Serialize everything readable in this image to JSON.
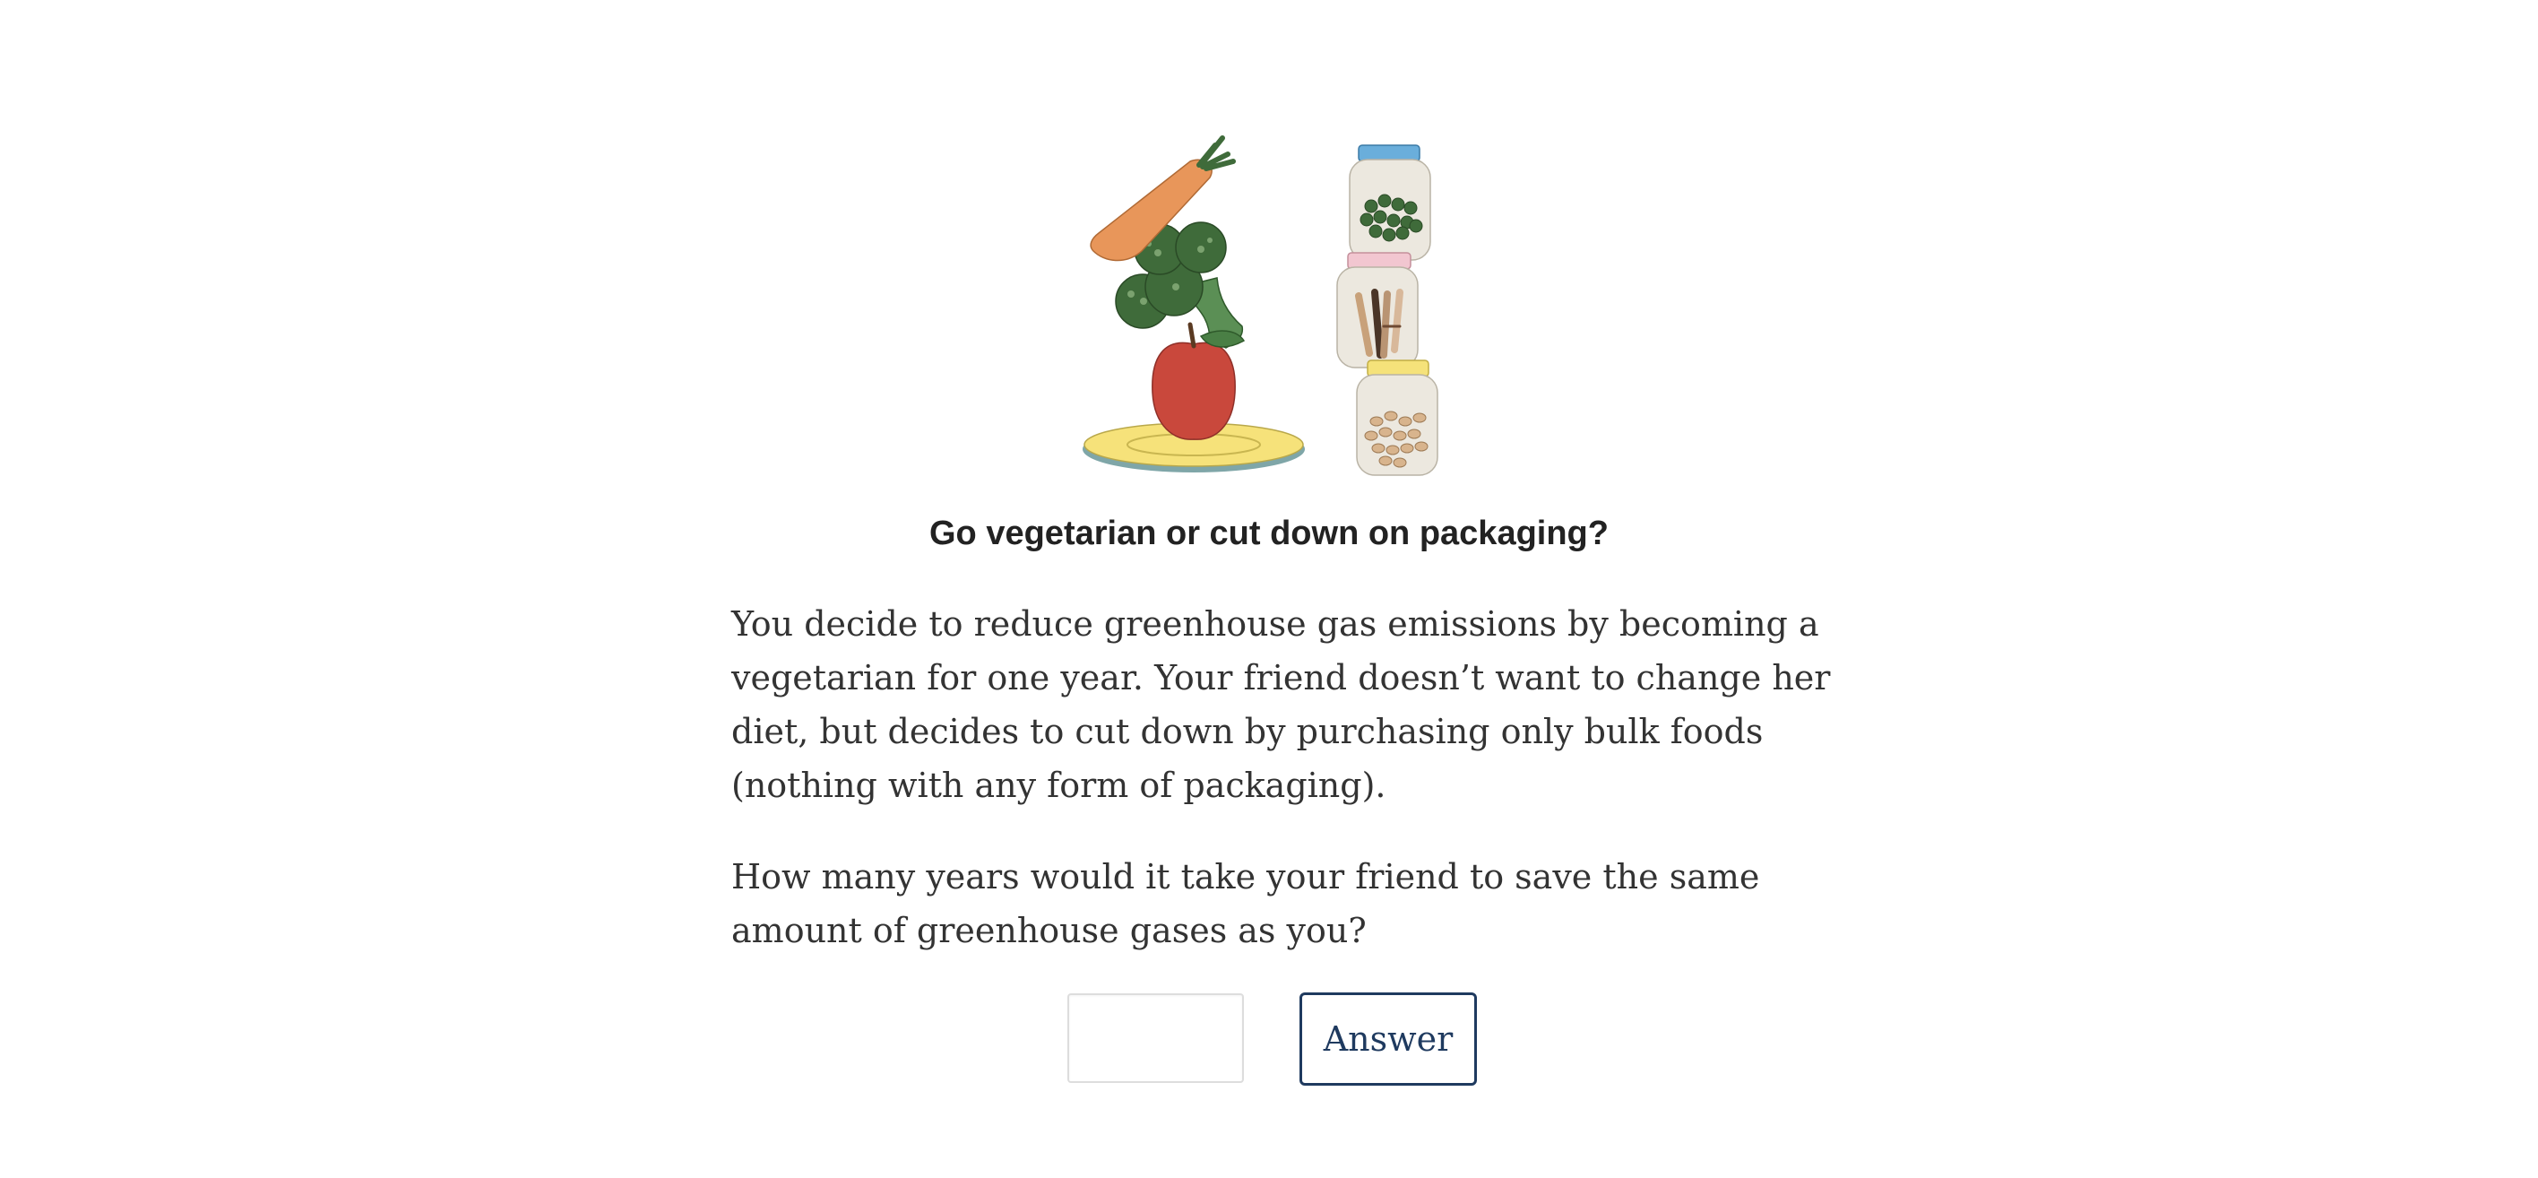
{
  "question": {
    "title": "Go vegetarian or cut down on packaging?",
    "paragraph1": "You decide to reduce greenhouse gas emissions by becoming a vegetarian for one year. Your friend doesn’t want to change her diet, but decides to cut down by purchasing only bulk foods (nothing with any form of packaging).",
    "paragraph2": "How many years would it take your friend to save the same amount of greenhouse gases as you?"
  },
  "answer": {
    "input_value": "",
    "input_placeholder": "",
    "button_label": "Answer"
  },
  "illustration": {
    "icons": [
      "carrot-icon",
      "broccoli-icon",
      "apple-icon",
      "plate-icon",
      "jar-peas-icon",
      "jar-sticks-icon",
      "jar-nuts-icon"
    ],
    "colors": {
      "carrot": "#e8965a",
      "broccoli": "#3f6b3a",
      "apple": "#c9483c",
      "plate": "#f6e27a",
      "jar_lid_blue": "#6aaedb",
      "jar_lid_pink": "#f2c6d0",
      "jar_lid_yellow": "#f5e27a",
      "jar_body": "#ece8df"
    }
  },
  "colors": {
    "button_border": "#1f3a5f",
    "text": "#333333",
    "input_border": "#dddddd"
  }
}
